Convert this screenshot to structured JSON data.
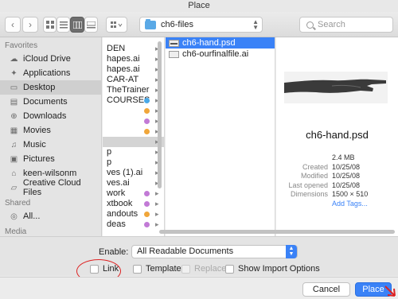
{
  "window": {
    "title": "Place"
  },
  "toolbar": {
    "back_icon": "chevron-left-icon",
    "forward_icon": "chevron-right-icon",
    "path_folder": "ch6-files",
    "search_placeholder": "Search"
  },
  "sidebar": {
    "favorites_header": "Favorites",
    "favorites": [
      {
        "label": "iCloud Drive",
        "icon": "cloud-icon"
      },
      {
        "label": "Applications",
        "icon": "applications-icon"
      },
      {
        "label": "Desktop",
        "icon": "desktop-icon",
        "selected": true
      },
      {
        "label": "Documents",
        "icon": "documents-icon"
      },
      {
        "label": "Downloads",
        "icon": "downloads-icon"
      },
      {
        "label": "Movies",
        "icon": "movies-icon"
      },
      {
        "label": "Music",
        "icon": "music-icon"
      },
      {
        "label": "Pictures",
        "icon": "pictures-icon"
      },
      {
        "label": "keen-wilsonm",
        "icon": "home-icon"
      },
      {
        "label": "Creative Cloud Files",
        "icon": "folder-icon"
      }
    ],
    "shared_header": "Shared",
    "shared": [
      {
        "label": "All...",
        "icon": "network-icon"
      }
    ],
    "media_header": "Media"
  },
  "column1": {
    "rows": [
      {
        "text": "DEN",
        "dot": null
      },
      {
        "text": "hapes.ai",
        "dot": null
      },
      {
        "text": "hapes.ai",
        "dot": null
      },
      {
        "text": "CAR-AT",
        "dot": null
      },
      {
        "text": "TheTrainer",
        "dot": null
      },
      {
        "text": "COURSES",
        "dot": "#4aa9e8"
      },
      {
        "text": "",
        "dot": "#f0a63a"
      },
      {
        "text": "",
        "dot": "#c27ad6"
      },
      {
        "text": "",
        "dot": "#f0a63a"
      },
      {
        "text": "",
        "dot": null,
        "selected": true
      },
      {
        "text": "p",
        "dot": null
      },
      {
        "text": "p",
        "dot": null
      },
      {
        "text": "ves (1).ai",
        "dot": null
      },
      {
        "text": "ves.ai",
        "dot": null
      },
      {
        "text": "work",
        "dot": "#c27ad6"
      },
      {
        "text": "xtbook",
        "dot": "#c27ad6"
      },
      {
        "text": "andouts",
        "dot": "#f0a63a"
      },
      {
        "text": "deas",
        "dot": "#c27ad6"
      }
    ]
  },
  "column2": {
    "files": [
      {
        "name": "ch6-hand.psd",
        "selected": true
      },
      {
        "name": "ch6-ourfinalfile.ai",
        "selected": false
      }
    ]
  },
  "preview": {
    "file_name": "ch6-hand.psd",
    "details": [
      {
        "key": "",
        "value": "2.4 MB"
      },
      {
        "key": "Created",
        "value": "10/25/08"
      },
      {
        "key": "Modified",
        "value": "10/25/08"
      },
      {
        "key": "Last opened",
        "value": "10/25/08"
      },
      {
        "key": "Dimensions",
        "value": "1500 × 510"
      }
    ],
    "add_tags": "Add Tags..."
  },
  "options": {
    "enable_label": "Enable:",
    "enable_value": "All Readable Documents",
    "link": "Link",
    "template": "Template",
    "replace": "Replace",
    "show_import_options": "Show Import Options"
  },
  "footer": {
    "cancel": "Cancel",
    "place": "Place"
  },
  "colors": {
    "accent": "#3a82f7",
    "annotation": "#dd2222"
  }
}
